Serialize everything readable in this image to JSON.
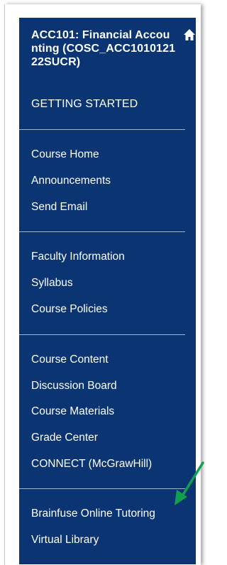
{
  "course": {
    "title": "ACC101: Financial Accounting (COSC_ACC101012122SUCR)",
    "section_label": "GETTING STARTED"
  },
  "icons": {
    "home": "home-icon",
    "annotation": "green-arrow-annotation"
  },
  "colors": {
    "sidebar_bg": "#0b3472",
    "text": "#ffffff",
    "divider": "#9fb3cf",
    "annotation_arrow": "#10a050"
  },
  "nav": {
    "group1": [
      "Course Home",
      "Announcements",
      "Send Email"
    ],
    "group2": [
      "Faculty Information",
      "Syllabus",
      "Course Policies"
    ],
    "group3": [
      "Course Content",
      "Discussion Board",
      "Course Materials",
      "Grade Center",
      "CONNECT (McGrawHill)"
    ],
    "group4": [
      "Brainfuse Online Tutoring",
      "Virtual Library"
    ]
  }
}
